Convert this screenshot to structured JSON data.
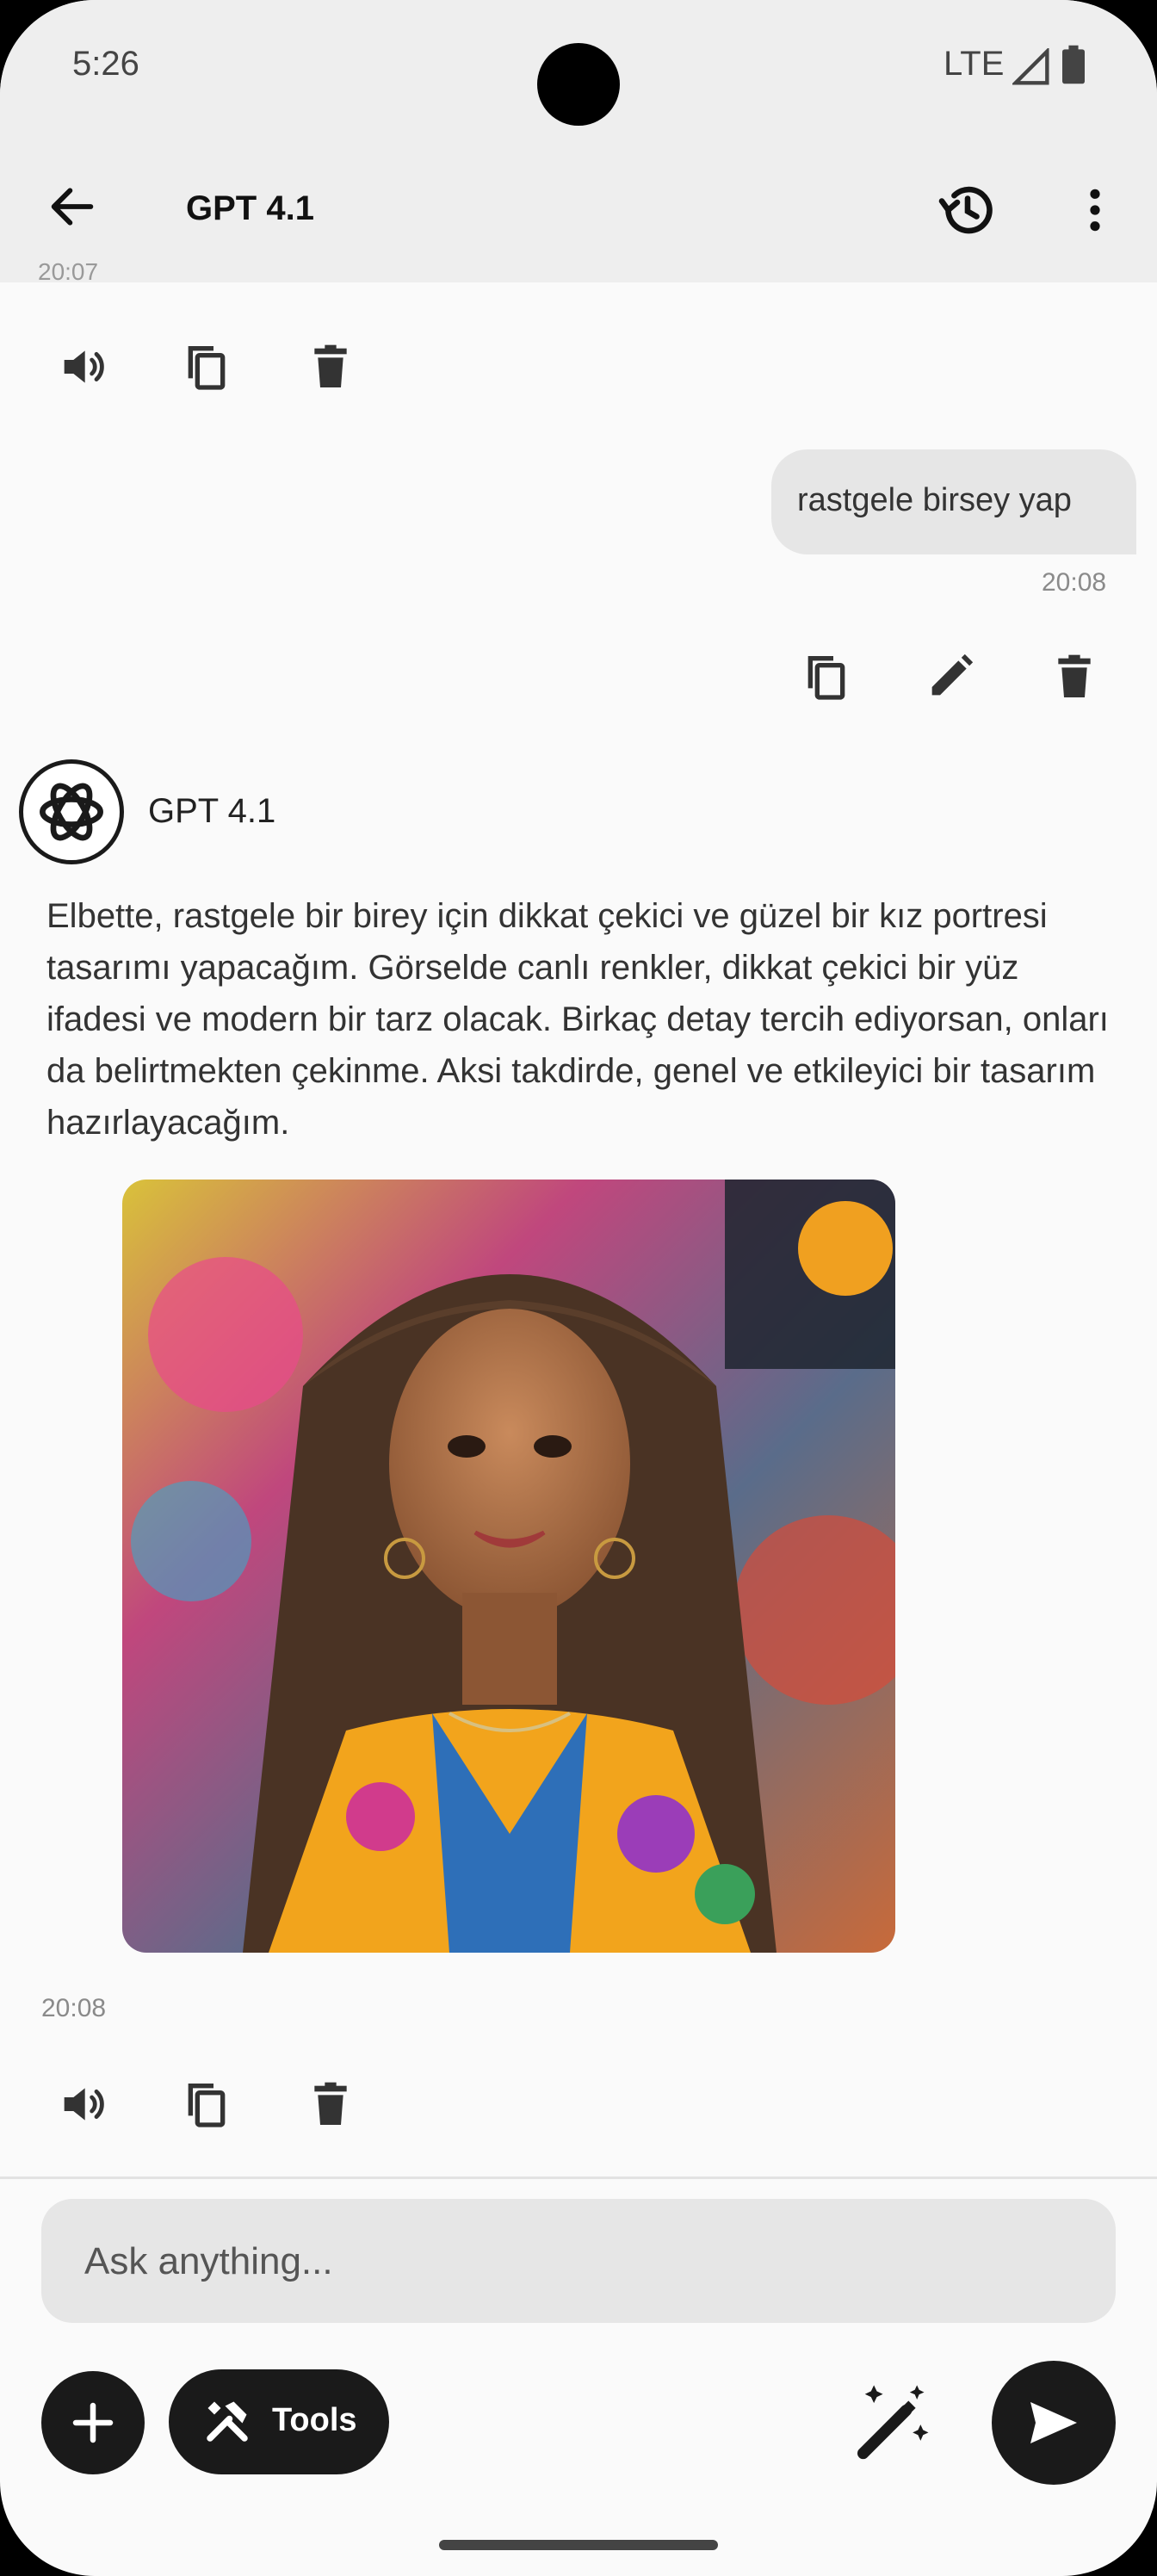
{
  "status_bar": {
    "time": "5:26",
    "network": "LTE"
  },
  "header": {
    "title": "GPT 4.1"
  },
  "conversation": {
    "clipped_timestamp": "20:07",
    "user_message": {
      "text": "rastgele birsey yap",
      "time": "20:08"
    },
    "assistant_message": {
      "model": "GPT 4.1",
      "text": "Elbette, rastgele bir birey için dikkat çekici ve güzel bir kız portresi tasarımı yapacağım. Görselde canlı renkler, dikkat çekici bir yüz ifadesi ve modern bir tarz olacak. Birkaç detay tercih ediyorsan, onları da belirtmekten çekinme. Aksi takdirde, genel ve etkileyici bir tasarım hazırlayacağım.",
      "time": "20:08"
    }
  },
  "composer": {
    "placeholder": "Ask anything...",
    "tools_label": "Tools"
  }
}
